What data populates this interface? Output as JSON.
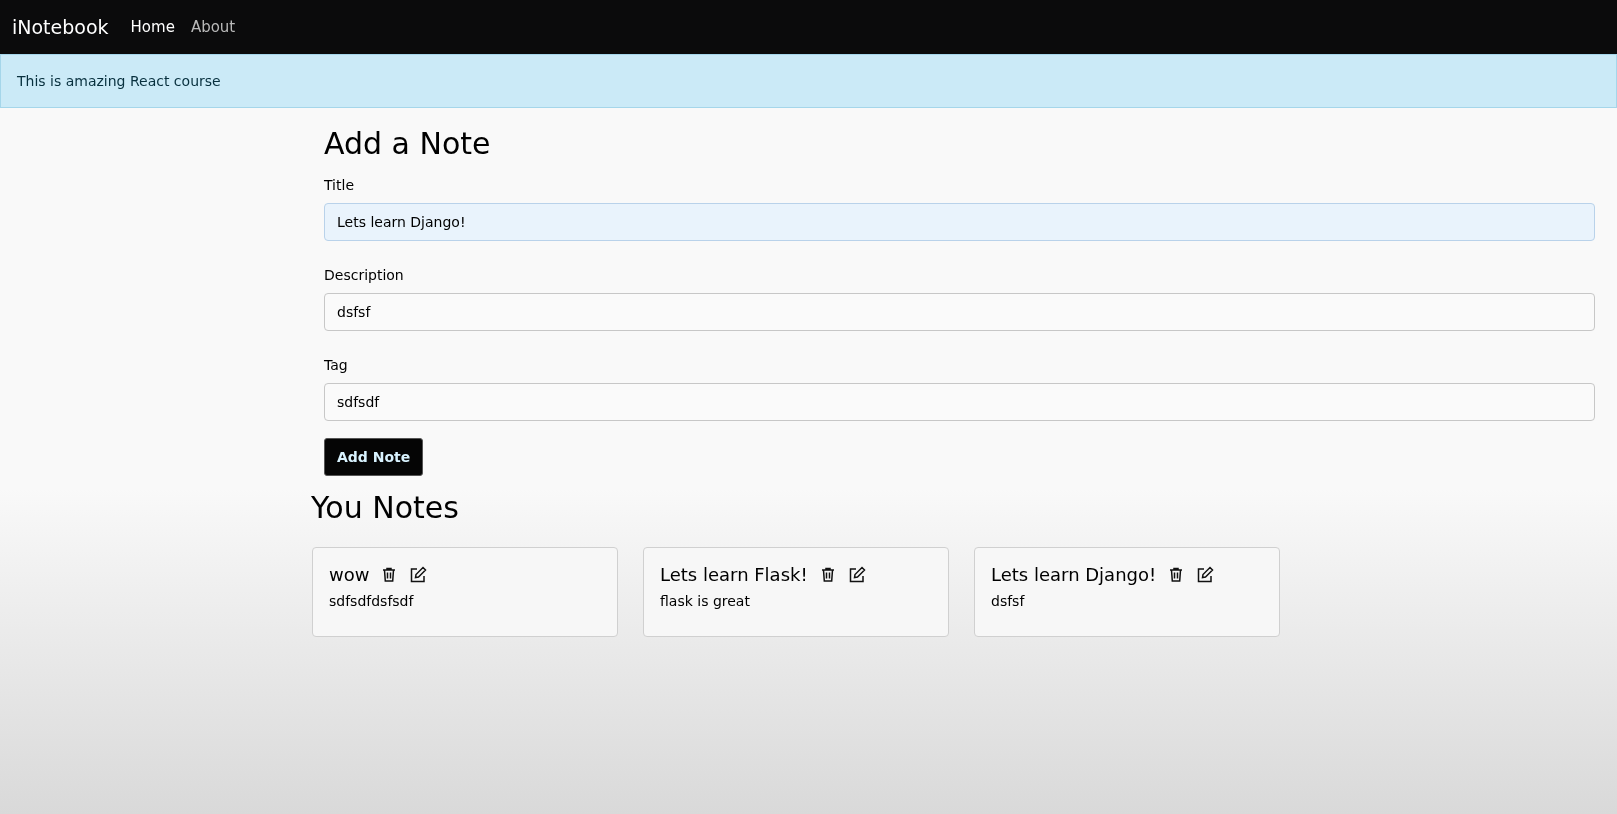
{
  "navbar": {
    "brand": "iNotebook",
    "links": [
      {
        "label": "Home",
        "selected": true
      },
      {
        "label": "About",
        "selected": false
      }
    ]
  },
  "alert": {
    "message": "This is amazing React course"
  },
  "form": {
    "heading": "Add a Note",
    "fields": [
      {
        "label": "Title",
        "value": "Lets learn Django!",
        "focused": true
      },
      {
        "label": "Description",
        "value": "dsfsf",
        "focused": false
      },
      {
        "label": "Tag",
        "value": "sdfsdf",
        "focused": false
      }
    ],
    "submit": "Add Note"
  },
  "notes_heading": "You Notes",
  "notes": [
    {
      "title": "wow",
      "description": "sdfsdfdsfsdf"
    },
    {
      "title": "Lets learn Flask!",
      "description": "flask is great"
    },
    {
      "title": "Lets learn Django!",
      "description": "dsfsf"
    }
  ]
}
